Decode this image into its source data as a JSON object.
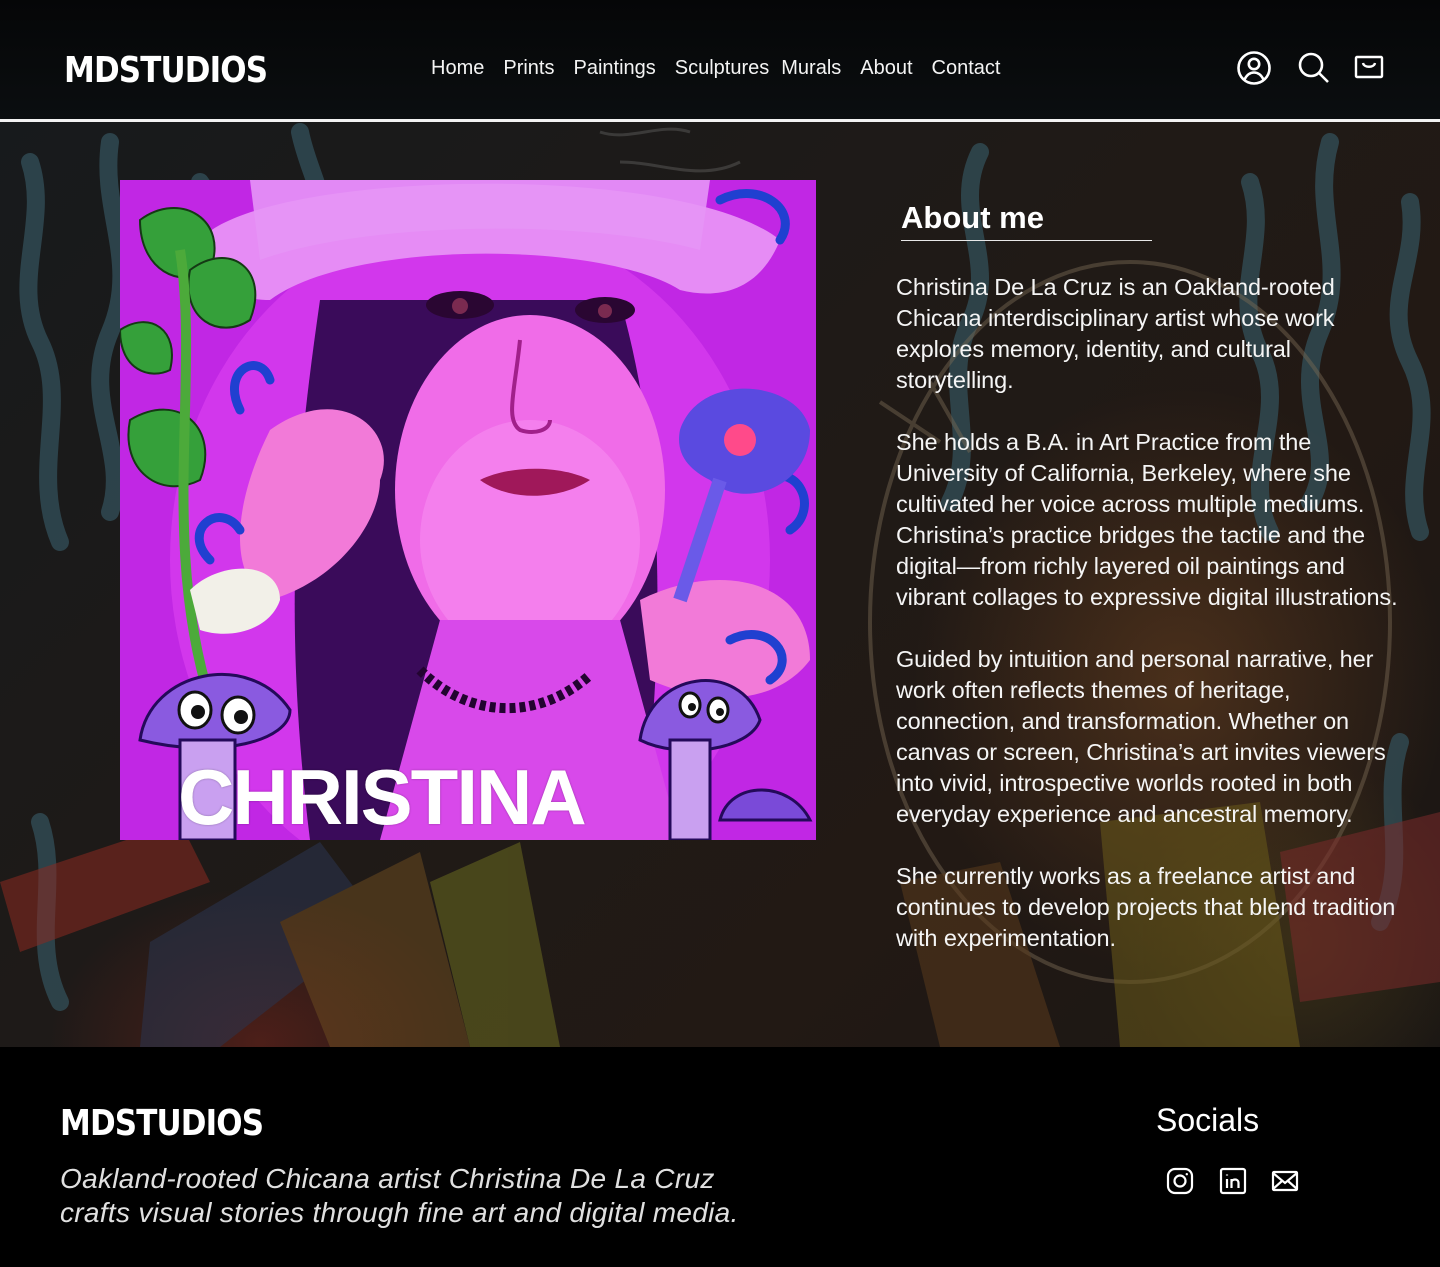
{
  "brand": "MDSTUDIOS",
  "nav": {
    "items": [
      "Home",
      "Prints",
      "Paintings",
      "Sculptures",
      "Murals",
      "About",
      "Contact"
    ]
  },
  "header_icons": [
    "account-icon",
    "search-icon",
    "cart-icon"
  ],
  "portrait": {
    "overlay_name": "CHRISTINA"
  },
  "about": {
    "title": "About me",
    "paragraphs": [
      "Christina De La Cruz is an Oakland-rooted Chicana interdisciplinary artist whose work explores memory, identity, and cultural storytelling.",
      "She holds a B.A. in Art Practice from the University of California, Berkeley, where she cultivated her voice across multiple mediums. Christina’s practice bridges the tactile and the digital—from richly layered oil paintings and vibrant collages to expressive digital illustrations.",
      "Guided by intuition and personal narrative, her work often reflects themes of heritage, connection, and transformation. Whether on canvas or screen, Christina’s art invites viewers into vivid, introspective worlds rooted in both everyday experience and ancestral memory.",
      "She currently works as a freelance artist and continues to develop projects that blend tradition with experimentation."
    ]
  },
  "footer": {
    "brand": "MDSTUDIOS",
    "tagline": "Oakland-rooted Chicana artist Christina De La Cruz crafts visual stories through fine art and digital media.",
    "socials_title": "Socials",
    "social_icons": [
      "instagram-icon",
      "linkedin-icon",
      "email-icon"
    ]
  },
  "colors": {
    "background": "#000000",
    "text": "#ffffff",
    "portrait_magenta": "#d22ee8"
  }
}
